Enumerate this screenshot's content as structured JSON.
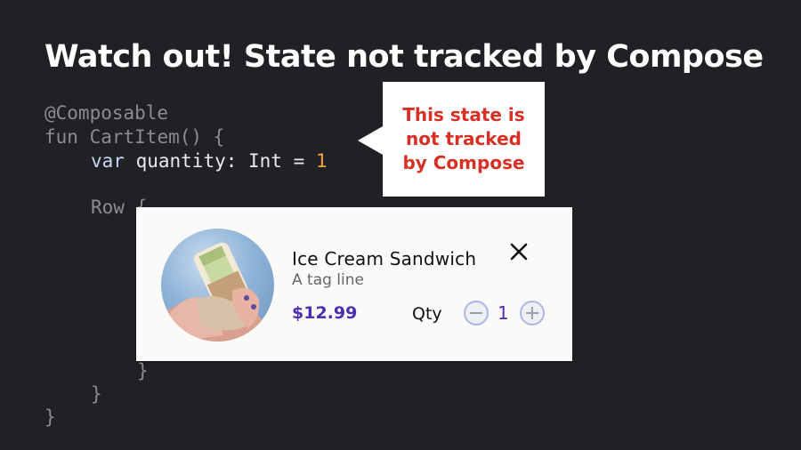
{
  "slide": {
    "title": "Watch out! State not tracked by Compose"
  },
  "code": {
    "annotation": "@Composable",
    "fun_keyword": "fun",
    "fun_signature": " CartItem() {",
    "var_keyword": "var",
    "var_name": " quantity: ",
    "var_type": "Int",
    "var_equals": " = ",
    "var_value": "1",
    "row_open": "Row {",
    "inner_close": "}",
    "row_close": "}",
    "fun_close": "}"
  },
  "callout": {
    "line1": "This state is",
    "line2": "not tracked",
    "line3": "by Compose",
    "color": "#d93025"
  },
  "cart_item": {
    "name": "Ice Cream Sandwich",
    "tagline": "A tag line",
    "price": "$12.99",
    "qty_label": "Qty",
    "quantity": "1",
    "accent": "#4a2fb0",
    "icons": {
      "close": "close-icon",
      "decrement": "minus-circle-icon",
      "increment": "plus-circle-icon"
    }
  }
}
